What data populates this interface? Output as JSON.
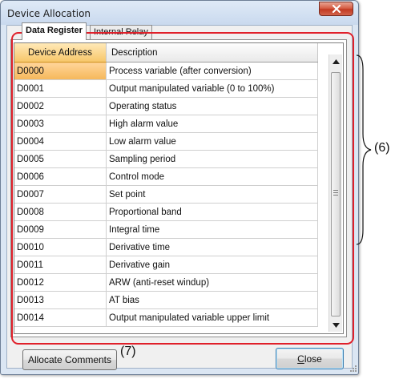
{
  "window": {
    "title": "Device Allocation"
  },
  "tabs": [
    {
      "label": "Data Register",
      "active": true
    },
    {
      "label": "Internal Relay",
      "active": false
    }
  ],
  "table": {
    "headers": [
      "Device Address",
      "Description"
    ],
    "rows": [
      [
        "D0000",
        "Process variable (after conversion)"
      ],
      [
        "D0001",
        "Output manipulated variable (0 to 100%)"
      ],
      [
        "D0002",
        "Operating status"
      ],
      [
        "D0003",
        "High alarm value"
      ],
      [
        "D0004",
        "Low alarm value"
      ],
      [
        "D0005",
        "Sampling period"
      ],
      [
        "D0006",
        "Control mode"
      ],
      [
        "D0007",
        "Set point"
      ],
      [
        "D0008",
        "Proportional band"
      ],
      [
        "D0009",
        "Integral time"
      ],
      [
        "D0010",
        "Derivative time"
      ],
      [
        "D0011",
        "Derivative gain"
      ],
      [
        "D0012",
        "ARW (anti-reset windup)"
      ],
      [
        "D0013",
        "AT bias"
      ],
      [
        "D0014",
        "Output manipulated variable upper limit"
      ]
    ],
    "selected_row": 0
  },
  "buttons": {
    "allocate_comments": "Allocate Comments",
    "close": "Close"
  },
  "annotations": {
    "callout_6": "(6)",
    "callout_7": "(7)"
  },
  "colors": {
    "annotation": "#e0202a",
    "selection": "#f5b75a",
    "close_button": "#c23a22"
  },
  "icons": [
    "close-icon",
    "scroll-up-icon",
    "scroll-down-icon",
    "resize-grip-icon"
  ]
}
